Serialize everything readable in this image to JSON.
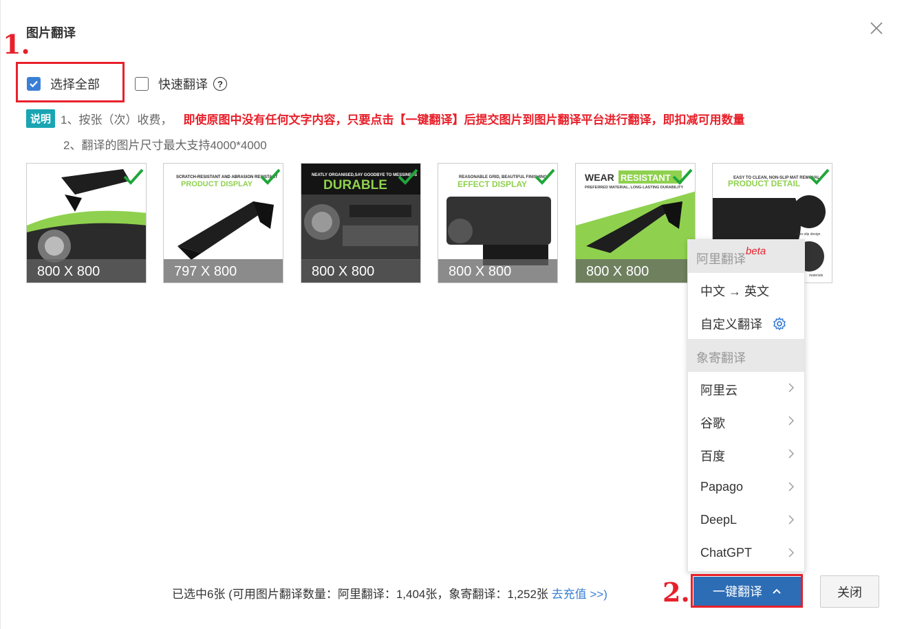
{
  "dialog": {
    "title": "图片翻译",
    "close_icon": "close-icon"
  },
  "annotations": {
    "marker1": "1.",
    "marker2": "2."
  },
  "options": {
    "select_all_label": "选择全部",
    "select_all_checked": true,
    "quick_translate_label": "快速翻译",
    "quick_translate_checked": false,
    "help_symbol": "?"
  },
  "notes": {
    "badge": "说明",
    "line1_prefix": "1、按张（次）收费，",
    "line1_highlight": "即使原图中没有任何文字内容，只要点击【一键翻译】后提交图片到图片翻译平台进行翻译，即扣减可用数量",
    "line2": "2、翻译的图片尺寸最大支持4000*4000"
  },
  "images": [
    {
      "dimensions": "800 X 800",
      "caption": "",
      "selected": true
    },
    {
      "dimensions": "797 X 800",
      "caption": "PRODUCT DISPLAY",
      "subcaption": "SCRATCH-RESISTANT AND ABRASION RESISTANT",
      "selected": true
    },
    {
      "dimensions": "800 X 800",
      "caption": "DURABLE",
      "subcaption": "NEATLY ORGANISED,SAY GOODBYE TO MESSINESS",
      "selected": true
    },
    {
      "dimensions": "800 X 800",
      "caption": "EFFECT DISPLAY",
      "subcaption": "REASONABLE GRID, BEAUTIFUL FINISHING",
      "selected": true
    },
    {
      "dimensions": "800 X 800",
      "caption": "WEAR",
      "caption2": "RESISTANT",
      "subcaption": "PREFERRED MATERIAL, LONG-LASTING DURABILITY",
      "selected": true
    },
    {
      "dimensions": "",
      "caption": "PRODUCT DETAIL",
      "subcaption": "EASY TO CLEAN, NON-SLIP MAT REMOVAL",
      "label_a": "Non-slip design",
      "label_b": "materials",
      "selected": true
    }
  ],
  "menu": {
    "group1": "阿里翻译",
    "group1_sup": "beta",
    "item_zh_en": "中文 → 英文",
    "item_custom": "自定义翻译",
    "group2": "象寄翻译",
    "providers": [
      "阿里云",
      "谷歌",
      "百度",
      "Papago",
      "DeepL",
      "ChatGPT"
    ]
  },
  "footer": {
    "summary": "已选中6张 (可用图片翻译数量：阿里翻译：1,404张，象寄翻译：1,252张",
    "recharge_link": "去充值 >>)",
    "translate_button": "一键翻译",
    "close_button": "关闭"
  },
  "colors": {
    "accent": "#2d6db5",
    "highlight_red": "#e8202a",
    "badge": "#19a5b3",
    "check_green": "#1fa63a"
  }
}
